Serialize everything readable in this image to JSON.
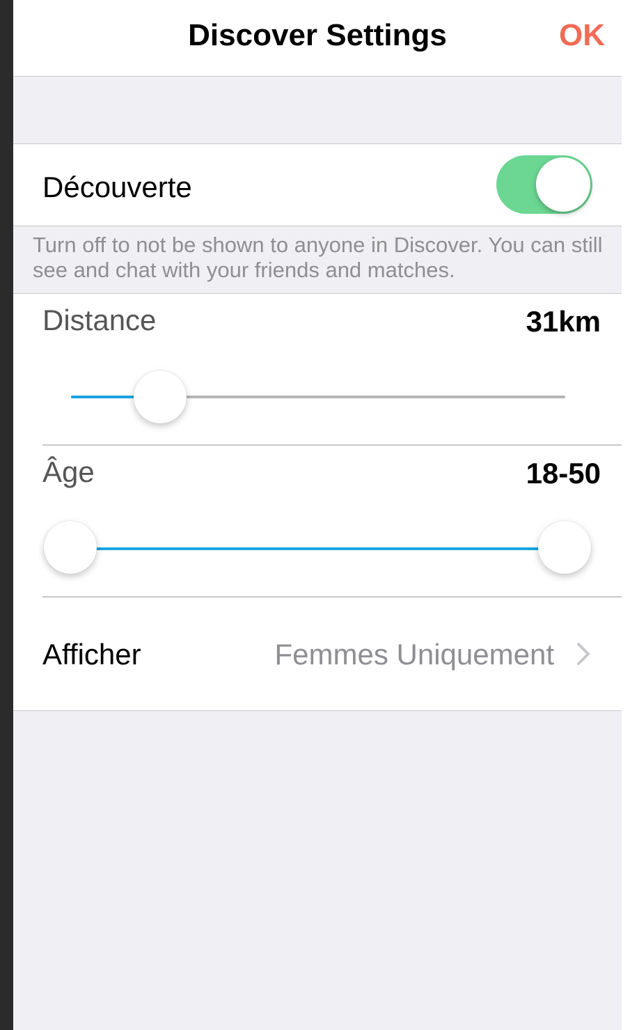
{
  "nav": {
    "title": "Discover Settings",
    "ok_label": "OK"
  },
  "discovery": {
    "label": "Découverte",
    "enabled": true,
    "footnote": "Turn off to not be shown to anyone in Discover. You can still see and chat with your friends and matches."
  },
  "distance": {
    "label": "Distance",
    "value_text": "31km",
    "fraction": 0.18
  },
  "age": {
    "label": "Âge",
    "value_text": "18-50",
    "min_fraction": 0.0,
    "max_fraction": 1.0
  },
  "show": {
    "label": "Afficher",
    "value": "Femmes Uniquement"
  },
  "colors": {
    "accent_ok": "#f26b56",
    "toggle_on": "#6bd793",
    "slider_fill": "#1aa4e1",
    "group_background": "#efeff4"
  }
}
